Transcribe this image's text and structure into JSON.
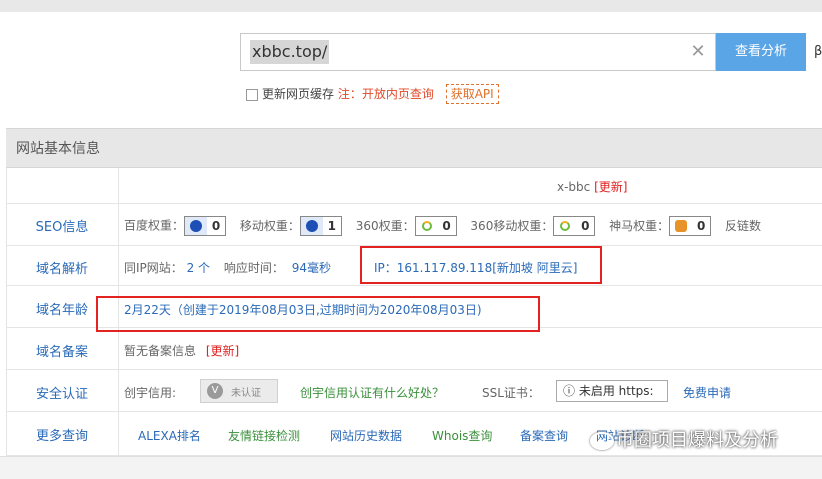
{
  "search": {
    "value": "xbbc.top/",
    "clear_label": "✕",
    "button_label": "查看分析",
    "cut_right": "β"
  },
  "cache": {
    "checkbox_label": "更新网页缓存",
    "note": "注：开放内页查询",
    "api_label": "获取API"
  },
  "panel": {
    "title": "网站基本信息"
  },
  "rows": {
    "name": {
      "site": "x-bbc",
      "update": "[更新]"
    },
    "seo": {
      "label": "SEO信息",
      "baidu": "百度权重：",
      "baidu_val": "0",
      "mobile": "移动权重：",
      "mobile_val": "1",
      "s360": "360权重：",
      "s360_val": "0",
      "s360m": "360移动权重：",
      "s360m_val": "0",
      "shenma": "神马权重：",
      "shenma_val": "0",
      "backlinks": "反链数"
    },
    "dns": {
      "label": "域名解析",
      "same_ip": "同IP网站：",
      "same_ip_val": "2 个",
      "resp": "响应时间：",
      "resp_val": "94毫秒",
      "ip": "IP：161.117.89.118[新加坡 阿里云]"
    },
    "age": {
      "label": "域名年龄",
      "value": "2月22天（创建于2019年08月03日,过期时间为2020年08月03日)"
    },
    "icp": {
      "label": "域名备案",
      "value": "暂无备案信息",
      "update": "[更新]"
    },
    "security": {
      "label": "安全认证",
      "chuangyu": "创宇信用:",
      "cert_text": "未认证",
      "cert_v": "V",
      "question": "创宇信用认证有什么好处？",
      "ssl": "SSL证书：",
      "ssl_val": "ⓘ 未启用 https:",
      "free": "免费申请"
    },
    "more": {
      "label": "更多查询",
      "links": [
        "ALEXA排名",
        "友情链接检测",
        "网站历史数据",
        "Whois查询",
        "备案查询",
        "网站诊断"
      ]
    }
  },
  "watermark": "币圈项目爆料及分析",
  "colors": {
    "accent": "#5aa5e6",
    "highlight": "#e32222",
    "link": "#2a6ab8",
    "green": "#3b8f3b"
  }
}
